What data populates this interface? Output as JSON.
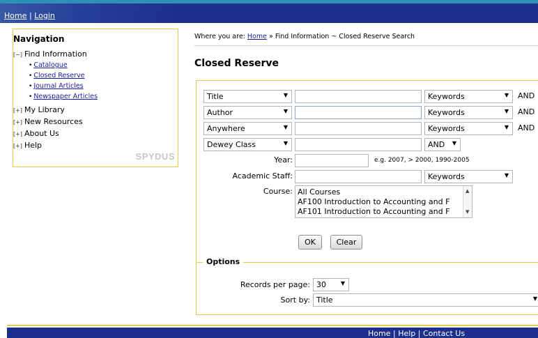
{
  "top_nav": {
    "home": "Home",
    "sep": "|",
    "login": "Login"
  },
  "navigation": {
    "title": "Navigation",
    "items": [
      {
        "toggle": "[−]",
        "label": "Find Information",
        "children": [
          "Catalogue",
          "Closed Reserve",
          "Journal Articles",
          "Newspaper Articles"
        ]
      },
      {
        "toggle": "[+]",
        "label": "My Library"
      },
      {
        "toggle": "[+]",
        "label": "New Resources"
      },
      {
        "toggle": "[+]",
        "label": "About Us"
      },
      {
        "toggle": "[+]",
        "label": "Help"
      }
    ],
    "logo_text": "SPYDUS"
  },
  "breadcrumb": {
    "prefix": "Where you are:",
    "home": "Home",
    "rest": "» Find Information ~ Closed Reserve Search"
  },
  "page_title": "Closed Reserve",
  "search_rows": [
    {
      "field": "Title",
      "value": "",
      "match": "Keywords",
      "op": "AND"
    },
    {
      "field": "Author",
      "value": "",
      "match": "Keywords",
      "op": "AND"
    },
    {
      "field": "Anywhere",
      "value": "",
      "match": "Keywords",
      "op": "AND"
    },
    {
      "field": "Dewey Class",
      "value": "",
      "op": "AND"
    }
  ],
  "year": {
    "label": "Year:",
    "value": "",
    "hint": "e.g. 2007, > 2000, 1990-2005"
  },
  "academic_staff": {
    "label": "Academic Staff:",
    "value": "",
    "match": "Keywords"
  },
  "course": {
    "label": "Course:",
    "options": [
      "All Courses",
      "AF100 Introduction to Accounting and F",
      "AF101 Introduction to Accounting and F"
    ]
  },
  "buttons": {
    "ok": "OK",
    "clear": "Clear"
  },
  "options": {
    "legend": "Options",
    "records_label": "Records per page:",
    "records_value": "30",
    "sort_label": "Sort by:",
    "sort_value": "Title"
  },
  "footer": {
    "home": "Home",
    "help": "Help",
    "contact": "Contact Us",
    "sep": "|"
  },
  "colors": {
    "header_blue": "#1d2f8c",
    "accent_yellow": "#e8c850",
    "link": "#1a1aa6"
  }
}
